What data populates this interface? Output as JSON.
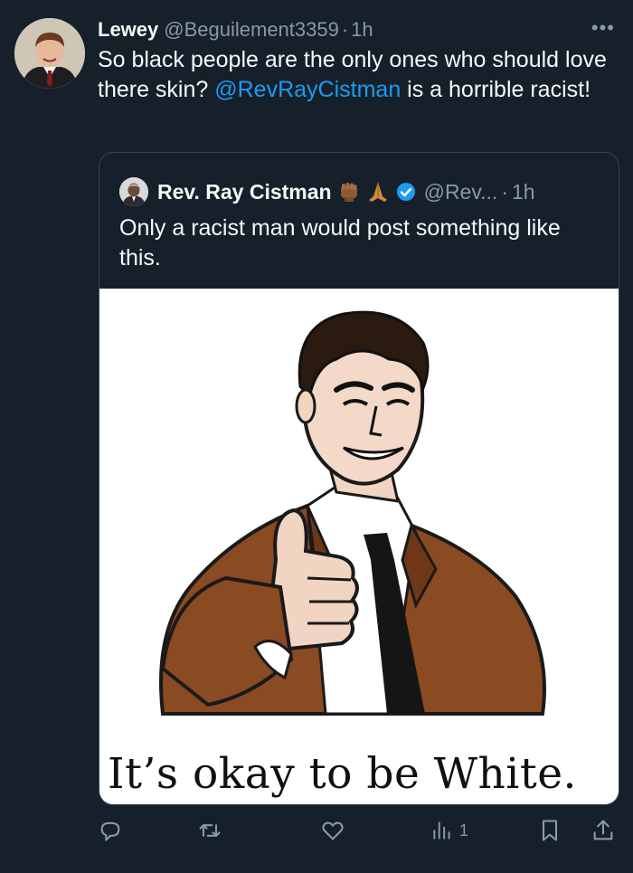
{
  "post": {
    "author_name": "Lewey",
    "author_handle": "@Beguilement3359",
    "separator": "·",
    "time": "1h",
    "more_label": "•••",
    "text_before": "So black people are the only ones who should love there skin? ",
    "mention": "@RevRayCistman",
    "text_after": " is a horrible racist!"
  },
  "quote": {
    "author_name": "Rev. Ray Cistman",
    "emoji": [
      "raised-fist-icon",
      "praying-hands-icon"
    ],
    "verified": true,
    "author_handle": "@Rev...",
    "separator": "·",
    "time": "1h",
    "text": "Only a racist man would post something like this.",
    "image_caption": "It’s okay to be White."
  },
  "actions": {
    "reply_count": "",
    "repost_count": "",
    "like_count": "",
    "views_count": "1"
  },
  "colors": {
    "background": "#15202b",
    "text": "#f7f9f9",
    "secondary": "#8b98a5",
    "link": "#1d9bf0",
    "verified": "#1d9bf0"
  }
}
